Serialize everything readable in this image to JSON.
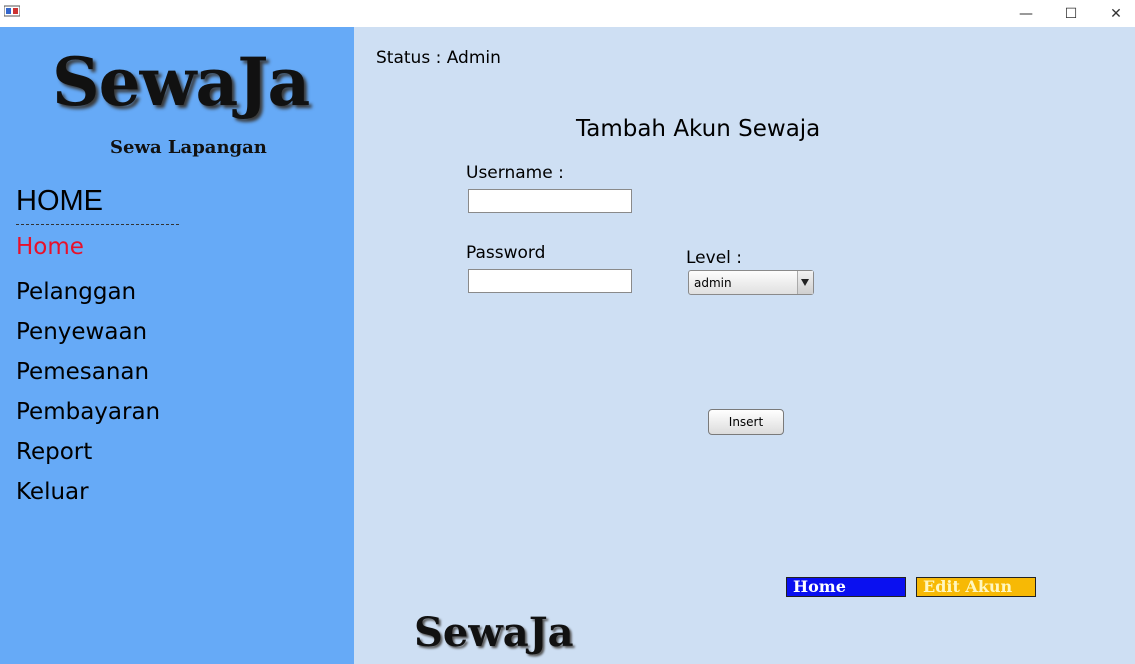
{
  "window": {
    "minimize_glyph": "—",
    "maximize_glyph": "☐",
    "close_glyph": "✕"
  },
  "sidebar": {
    "logo_text": "SewaJa",
    "logo_subtitle": "Sewa Lapangan",
    "heading": "HOME",
    "items": [
      {
        "label": "Home",
        "active": true
      },
      {
        "label": "Pelanggan"
      },
      {
        "label": "Penyewaan"
      },
      {
        "label": "Pemesanan"
      },
      {
        "label": "Pembayaran"
      },
      {
        "label": "Report"
      },
      {
        "label": "Keluar"
      }
    ]
  },
  "main": {
    "status_label": "Status :",
    "status_value": "Admin",
    "form_title": "Tambah Akun Sewaja",
    "username_label": "Username :",
    "username_value": "",
    "password_label": "Password",
    "password_value": "",
    "level_label": "Level :",
    "level_selected": "admin",
    "insert_label": "Insert",
    "home_button": "Home",
    "edit_button": "Edit Akun",
    "footer_logo": "SewaJa"
  },
  "colors": {
    "sidebar_bg": "#66aaf7",
    "main_bg": "#cedff3",
    "active_nav": "#e8102a",
    "home_button_bg": "#0a10f0",
    "edit_button_bg": "#f7b905"
  }
}
